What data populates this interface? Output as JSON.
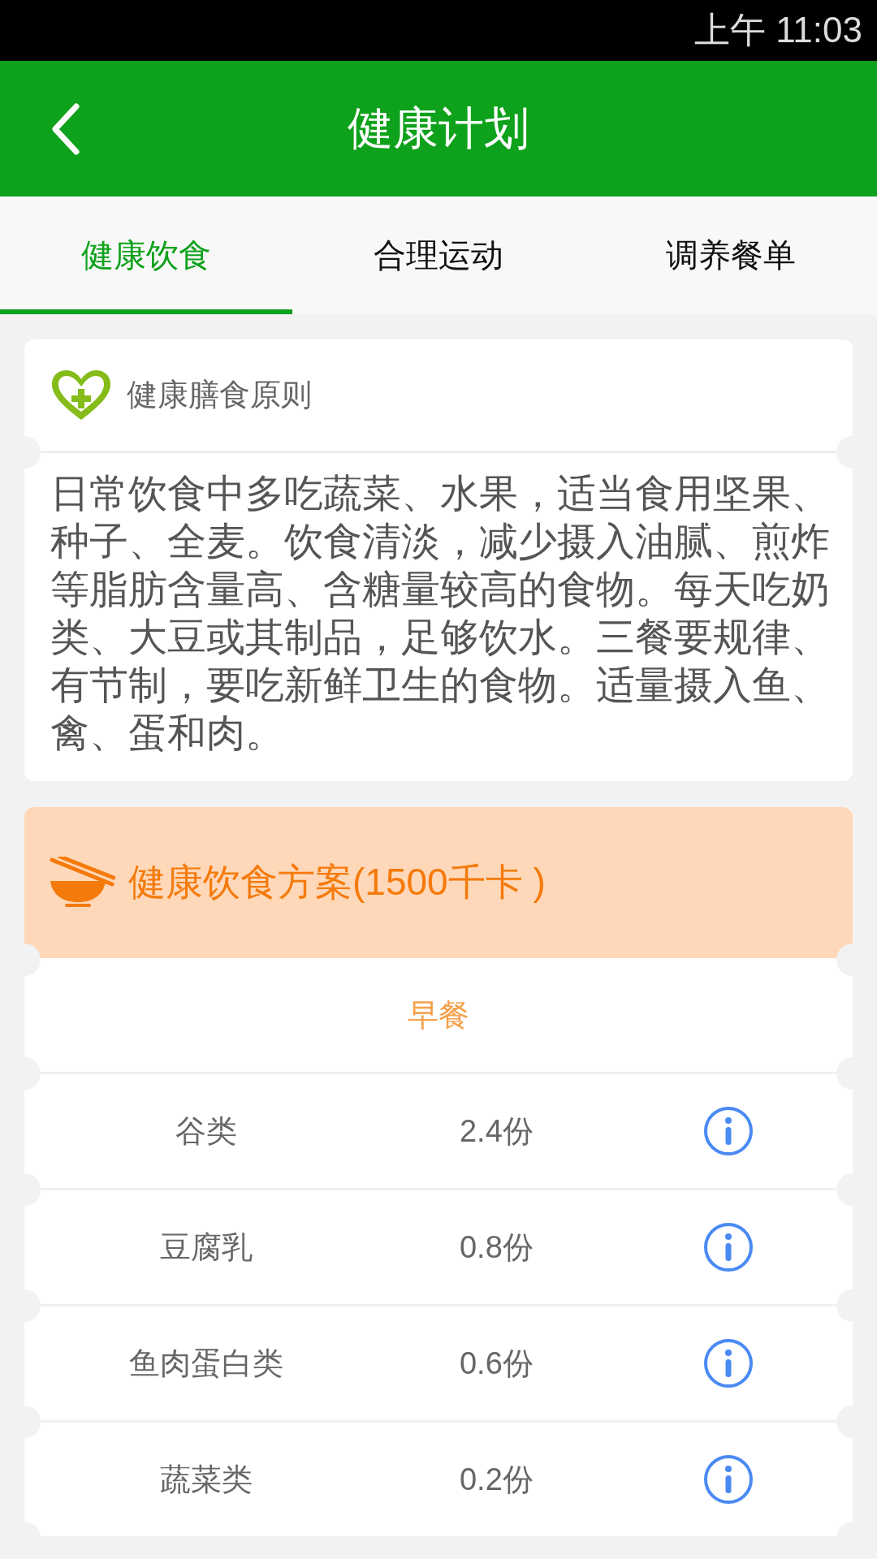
{
  "status_bar": {
    "time": "上午 11:03"
  },
  "header": {
    "title": "健康计划"
  },
  "tabs": [
    {
      "label": "健康饮食",
      "selected": true
    },
    {
      "label": "合理运动",
      "selected": false
    },
    {
      "label": "调养餐单",
      "selected": false
    }
  ],
  "principle_card": {
    "title": "健康膳食原则",
    "text": "日常饮食中多吃蔬菜、水果，适当食用坚果、种子、全麦。饮食清淡，减少摄入油腻、煎炸等脂肪含量高、含糖量较高的食物。每天吃奶类、大豆或其制品，足够饮水。三餐要规律、有节制，要吃新鲜卫生的食物。适量摄入鱼、禽、蛋和肉。"
  },
  "plan_card": {
    "title": "健康饮食方案(1500千卡 )",
    "meal": "早餐",
    "rows": [
      {
        "food": "谷类",
        "amount": "2.4份"
      },
      {
        "food": "豆腐乳",
        "amount": "0.8份"
      },
      {
        "food": "鱼肉蛋白类",
        "amount": "0.6份"
      },
      {
        "food": "蔬菜类",
        "amount": "0.2份"
      }
    ]
  }
}
